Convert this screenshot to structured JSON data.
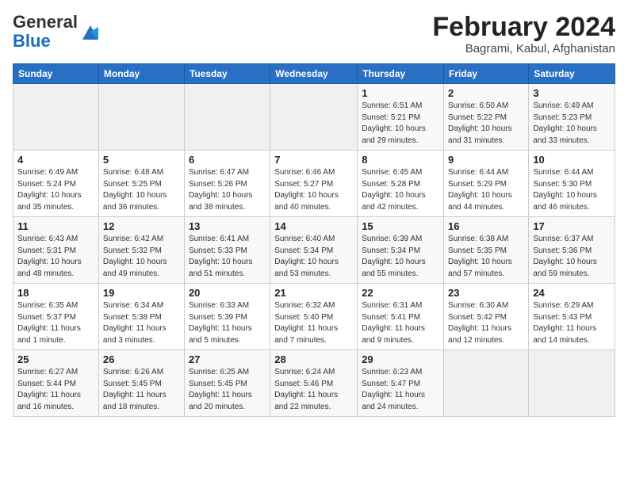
{
  "header": {
    "logo_general": "General",
    "logo_blue": "Blue",
    "month_title": "February 2024",
    "location": "Bagrami, Kabul, Afghanistan"
  },
  "days_of_week": [
    "Sunday",
    "Monday",
    "Tuesday",
    "Wednesday",
    "Thursday",
    "Friday",
    "Saturday"
  ],
  "weeks": [
    [
      {
        "day": "",
        "detail": ""
      },
      {
        "day": "",
        "detail": ""
      },
      {
        "day": "",
        "detail": ""
      },
      {
        "day": "",
        "detail": ""
      },
      {
        "day": "1",
        "detail": "Sunrise: 6:51 AM\nSunset: 5:21 PM\nDaylight: 10 hours and 29 minutes."
      },
      {
        "day": "2",
        "detail": "Sunrise: 6:50 AM\nSunset: 5:22 PM\nDaylight: 10 hours and 31 minutes."
      },
      {
        "day": "3",
        "detail": "Sunrise: 6:49 AM\nSunset: 5:23 PM\nDaylight: 10 hours and 33 minutes."
      }
    ],
    [
      {
        "day": "4",
        "detail": "Sunrise: 6:49 AM\nSunset: 5:24 PM\nDaylight: 10 hours and 35 minutes."
      },
      {
        "day": "5",
        "detail": "Sunrise: 6:48 AM\nSunset: 5:25 PM\nDaylight: 10 hours and 36 minutes."
      },
      {
        "day": "6",
        "detail": "Sunrise: 6:47 AM\nSunset: 5:26 PM\nDaylight: 10 hours and 38 minutes."
      },
      {
        "day": "7",
        "detail": "Sunrise: 6:46 AM\nSunset: 5:27 PM\nDaylight: 10 hours and 40 minutes."
      },
      {
        "day": "8",
        "detail": "Sunrise: 6:45 AM\nSunset: 5:28 PM\nDaylight: 10 hours and 42 minutes."
      },
      {
        "day": "9",
        "detail": "Sunrise: 6:44 AM\nSunset: 5:29 PM\nDaylight: 10 hours and 44 minutes."
      },
      {
        "day": "10",
        "detail": "Sunrise: 6:44 AM\nSunset: 5:30 PM\nDaylight: 10 hours and 46 minutes."
      }
    ],
    [
      {
        "day": "11",
        "detail": "Sunrise: 6:43 AM\nSunset: 5:31 PM\nDaylight: 10 hours and 48 minutes."
      },
      {
        "day": "12",
        "detail": "Sunrise: 6:42 AM\nSunset: 5:32 PM\nDaylight: 10 hours and 49 minutes."
      },
      {
        "day": "13",
        "detail": "Sunrise: 6:41 AM\nSunset: 5:33 PM\nDaylight: 10 hours and 51 minutes."
      },
      {
        "day": "14",
        "detail": "Sunrise: 6:40 AM\nSunset: 5:34 PM\nDaylight: 10 hours and 53 minutes."
      },
      {
        "day": "15",
        "detail": "Sunrise: 6:39 AM\nSunset: 5:34 PM\nDaylight: 10 hours and 55 minutes."
      },
      {
        "day": "16",
        "detail": "Sunrise: 6:38 AM\nSunset: 5:35 PM\nDaylight: 10 hours and 57 minutes."
      },
      {
        "day": "17",
        "detail": "Sunrise: 6:37 AM\nSunset: 5:36 PM\nDaylight: 10 hours and 59 minutes."
      }
    ],
    [
      {
        "day": "18",
        "detail": "Sunrise: 6:35 AM\nSunset: 5:37 PM\nDaylight: 11 hours and 1 minute."
      },
      {
        "day": "19",
        "detail": "Sunrise: 6:34 AM\nSunset: 5:38 PM\nDaylight: 11 hours and 3 minutes."
      },
      {
        "day": "20",
        "detail": "Sunrise: 6:33 AM\nSunset: 5:39 PM\nDaylight: 11 hours and 5 minutes."
      },
      {
        "day": "21",
        "detail": "Sunrise: 6:32 AM\nSunset: 5:40 PM\nDaylight: 11 hours and 7 minutes."
      },
      {
        "day": "22",
        "detail": "Sunrise: 6:31 AM\nSunset: 5:41 PM\nDaylight: 11 hours and 9 minutes."
      },
      {
        "day": "23",
        "detail": "Sunrise: 6:30 AM\nSunset: 5:42 PM\nDaylight: 11 hours and 12 minutes."
      },
      {
        "day": "24",
        "detail": "Sunrise: 6:29 AM\nSunset: 5:43 PM\nDaylight: 11 hours and 14 minutes."
      }
    ],
    [
      {
        "day": "25",
        "detail": "Sunrise: 6:27 AM\nSunset: 5:44 PM\nDaylight: 11 hours and 16 minutes."
      },
      {
        "day": "26",
        "detail": "Sunrise: 6:26 AM\nSunset: 5:45 PM\nDaylight: 11 hours and 18 minutes."
      },
      {
        "day": "27",
        "detail": "Sunrise: 6:25 AM\nSunset: 5:45 PM\nDaylight: 11 hours and 20 minutes."
      },
      {
        "day": "28",
        "detail": "Sunrise: 6:24 AM\nSunset: 5:46 PM\nDaylight: 11 hours and 22 minutes."
      },
      {
        "day": "29",
        "detail": "Sunrise: 6:23 AM\nSunset: 5:47 PM\nDaylight: 11 hours and 24 minutes."
      },
      {
        "day": "",
        "detail": ""
      },
      {
        "day": "",
        "detail": ""
      }
    ]
  ]
}
